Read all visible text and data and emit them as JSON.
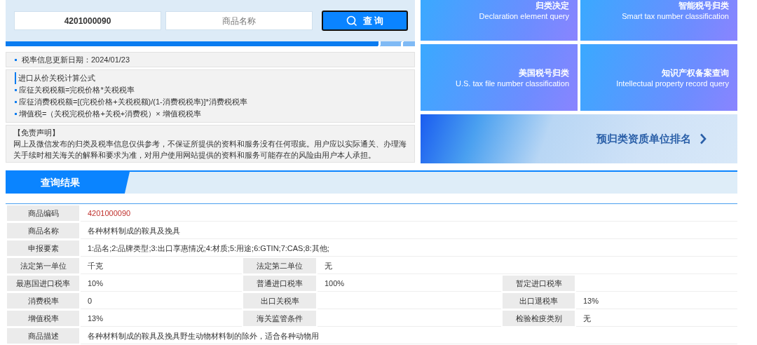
{
  "search": {
    "code_value": "4201000090",
    "name_placeholder": "商品名称",
    "button": "查 询"
  },
  "update_notice": "税率信息更新日期：2024/01/23",
  "formula": {
    "title": "进口从价关税计算公式",
    "items": [
      "应征关税税额=完税价格*关税税率",
      "应征消费税税额=[(完税价格+关税税额)/(1-消费税税率)]*消费税税率",
      "增值税=（关税完税价格+关税+消费税）× 增值税税率"
    ]
  },
  "disclaimer": {
    "title": "【免责声明】",
    "text": "网上及微信发布的归类及税率信息仅供参考，不保证所提供的资料和服务没有任何瑕疵。用户应以实际通关、办理海关手续时相关海关的解释和要求为准，对用户使用网站提供的资料和服务可能存在的风险由用户本人承担。"
  },
  "tiles": [
    {
      "title": "归类决定",
      "subtitle": "Declaration element query"
    },
    {
      "title": "智能税号归类",
      "subtitle": "Smart tax number classification"
    },
    {
      "title": "美国税号归类",
      "subtitle": "U.S. tax file number classification"
    },
    {
      "title": "知识产权备案查询",
      "subtitle": "Intellectual property record query"
    }
  ],
  "banner": {
    "title": "预归类资质单位排名"
  },
  "results": {
    "title": "查询结果",
    "rows": [
      {
        "fields": [
          {
            "label": "商品编码",
            "value": "4201000090",
            "highlight": true
          }
        ]
      },
      {
        "fields": [
          {
            "label": "商品名称",
            "value": "各种材料制成的鞍具及挽具",
            "highlight": false
          }
        ]
      },
      {
        "fields": [
          {
            "label": "申报要素",
            "value": "1:品名;2:品牌类型;3:出口享惠情况;4:材质;5:用途;6:GTIN;7:CAS;8:其他;",
            "highlight": false
          }
        ]
      },
      {
        "fields": [
          {
            "label": "法定第一单位",
            "value": "千克",
            "highlight": false
          },
          {
            "label": "法定第二单位",
            "value": "无",
            "highlight": false
          }
        ]
      },
      {
        "fields": [
          {
            "label": "最惠国进口税率",
            "value": "10%",
            "highlight": false
          },
          {
            "label": "普通进口税率",
            "value": "100%",
            "highlight": false
          },
          {
            "label": "暂定进口税率"
          }
        ]
      },
      {
        "fields": [
          {
            "label": "消费税率",
            "value": "0",
            "highlight": false
          },
          {
            "label": "出口关税率"
          },
          {
            "label": "出口退税率",
            "value": "13%",
            "highlight": false
          }
        ]
      },
      {
        "fields": [
          {
            "label": "增值税率",
            "value": "13%",
            "highlight": false
          },
          {
            "label": "海关监管条件"
          },
          {
            "label": "检验检疫类别",
            "value": "无",
            "highlight": false
          }
        ]
      },
      {
        "fields": [
          {
            "label": "商品描述",
            "value": "各种材料制成的鞍具及挽具野生动物材料制的除外，适合各种动物用",
            "highlight": false
          }
        ]
      }
    ]
  }
}
